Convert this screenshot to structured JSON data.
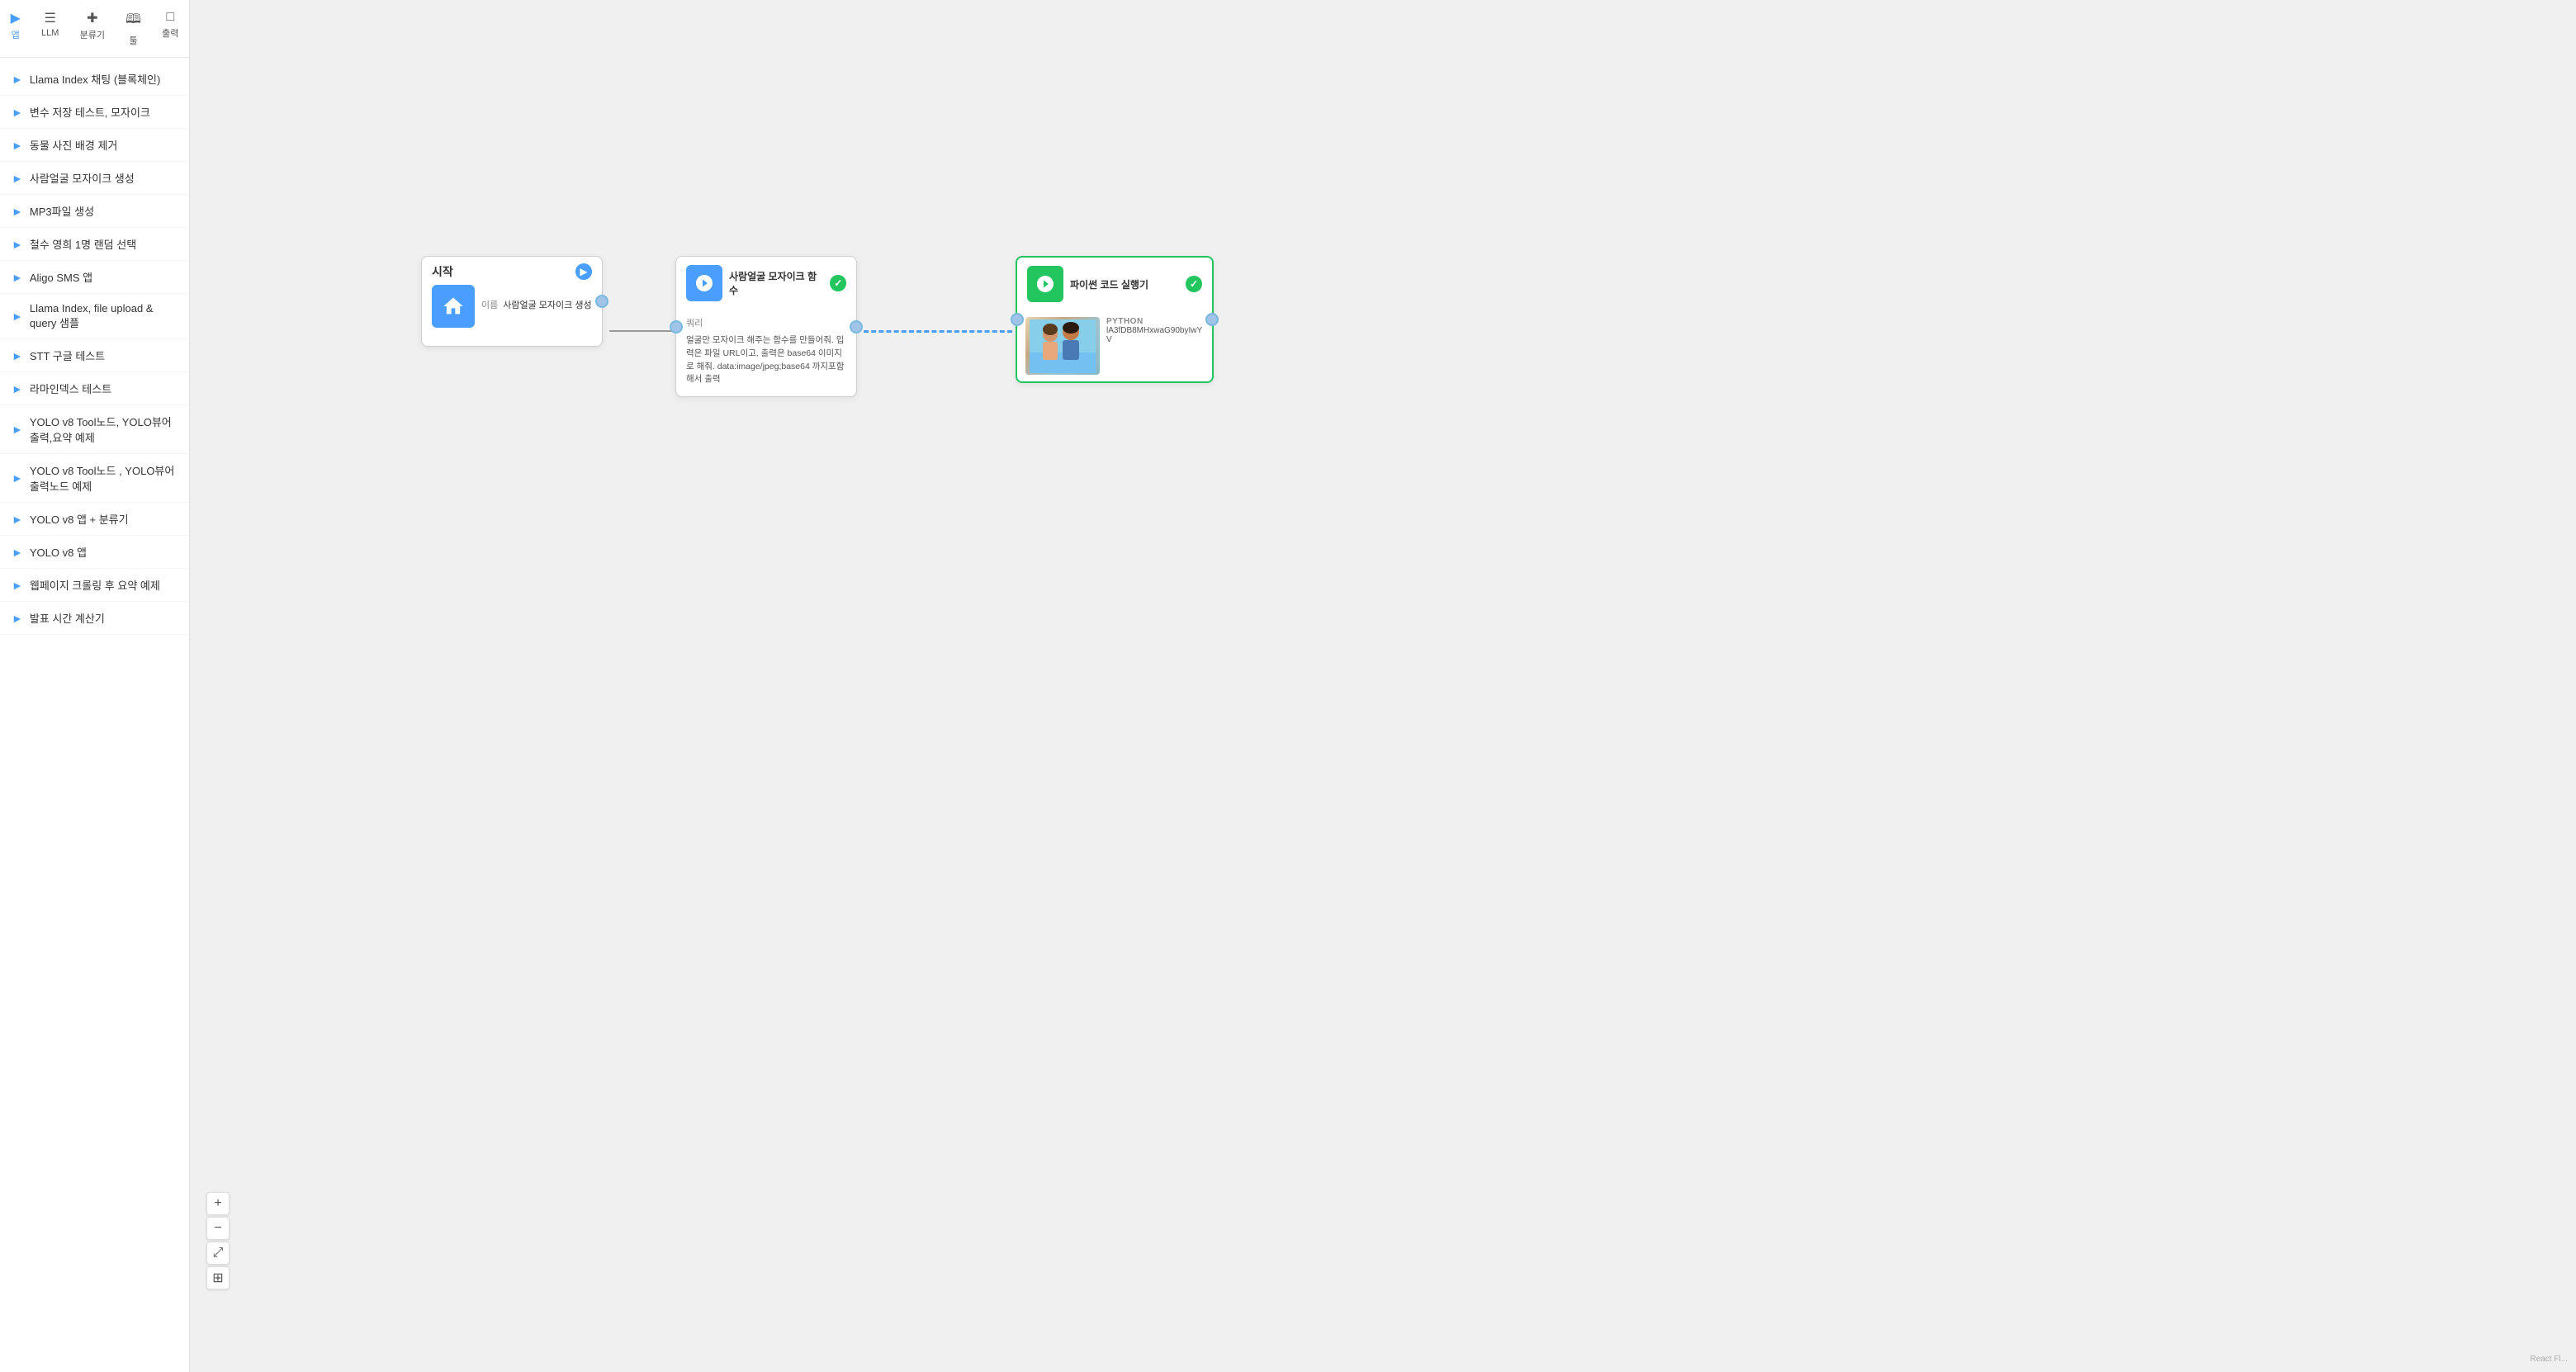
{
  "sidebar": {
    "nav_items": [
      {
        "id": "app",
        "label": "앱",
        "icon": "▶"
      },
      {
        "id": "llm",
        "label": "LLM",
        "icon": "☰"
      },
      {
        "id": "classifier",
        "label": "분류기",
        "icon": "⊞"
      },
      {
        "id": "tools",
        "label": "툴",
        "icon": "⊕"
      },
      {
        "id": "output",
        "label": "출력",
        "icon": "⬚"
      }
    ],
    "items": [
      {
        "label": "Llama Index 채팅 (블록체인)"
      },
      {
        "label": "변수 저장 테스트, 모자이크"
      },
      {
        "label": "동물 사진 배경 제거"
      },
      {
        "label": "사람얼굴 모자이크 생성"
      },
      {
        "label": "MP3파일 생성"
      },
      {
        "label": "철수 영희 1명 랜덤 선택"
      },
      {
        "label": "Aligo SMS 앱"
      },
      {
        "label": "Llama Index, file upload & query 샘플"
      },
      {
        "label": "STT 구글 테스트"
      },
      {
        "label": "라마인덱스 테스트"
      },
      {
        "label": "YOLO v8 Tool노드, YOLO뷰어 출력,요약 예제"
      },
      {
        "label": "YOLO v8 Tool노드 , YOLO뷰어 출력노드 예제"
      },
      {
        "label": "YOLO v8 앱 + 분류기"
      },
      {
        "label": "YOLO v8 앱"
      },
      {
        "label": "웹페이지 크롤링 후 요약 예제"
      },
      {
        "label": "발표 시간 계산기"
      }
    ]
  },
  "canvas": {
    "nodes": [
      {
        "id": "start",
        "type": "start",
        "title": "시작",
        "icon": "home",
        "color": "blue",
        "fields": [
          {
            "label": "이름",
            "value": "사람얼굴 모자이크 생성"
          }
        ]
      },
      {
        "id": "mosaic_func",
        "type": "function",
        "title": "사람얼굴 모자이크 함수",
        "icon": "python",
        "color": "blue",
        "badge": "check",
        "description": "얼굴만 모자이크 해주는 함수를 만들어줘. 입력은 파일 URL이고, 출력은 base64 이미지로 해줘. data:image/jpeg;base64 까지포함해서 출력",
        "fields": [
          {
            "label": "쿼리",
            "value": ""
          }
        ]
      },
      {
        "id": "python_runner",
        "type": "python",
        "title": "파이썬 코드 실행기",
        "icon": "python",
        "color": "green",
        "badge": "check",
        "tag": "PYTHON",
        "code_preview": "lA3fDB8MHxwaG90byIwYV"
      }
    ],
    "zoom_controls": {
      "plus": "+",
      "minus": "−",
      "fit": "⤢",
      "save": "⊞"
    }
  },
  "bottom_hint": "React Fl..."
}
